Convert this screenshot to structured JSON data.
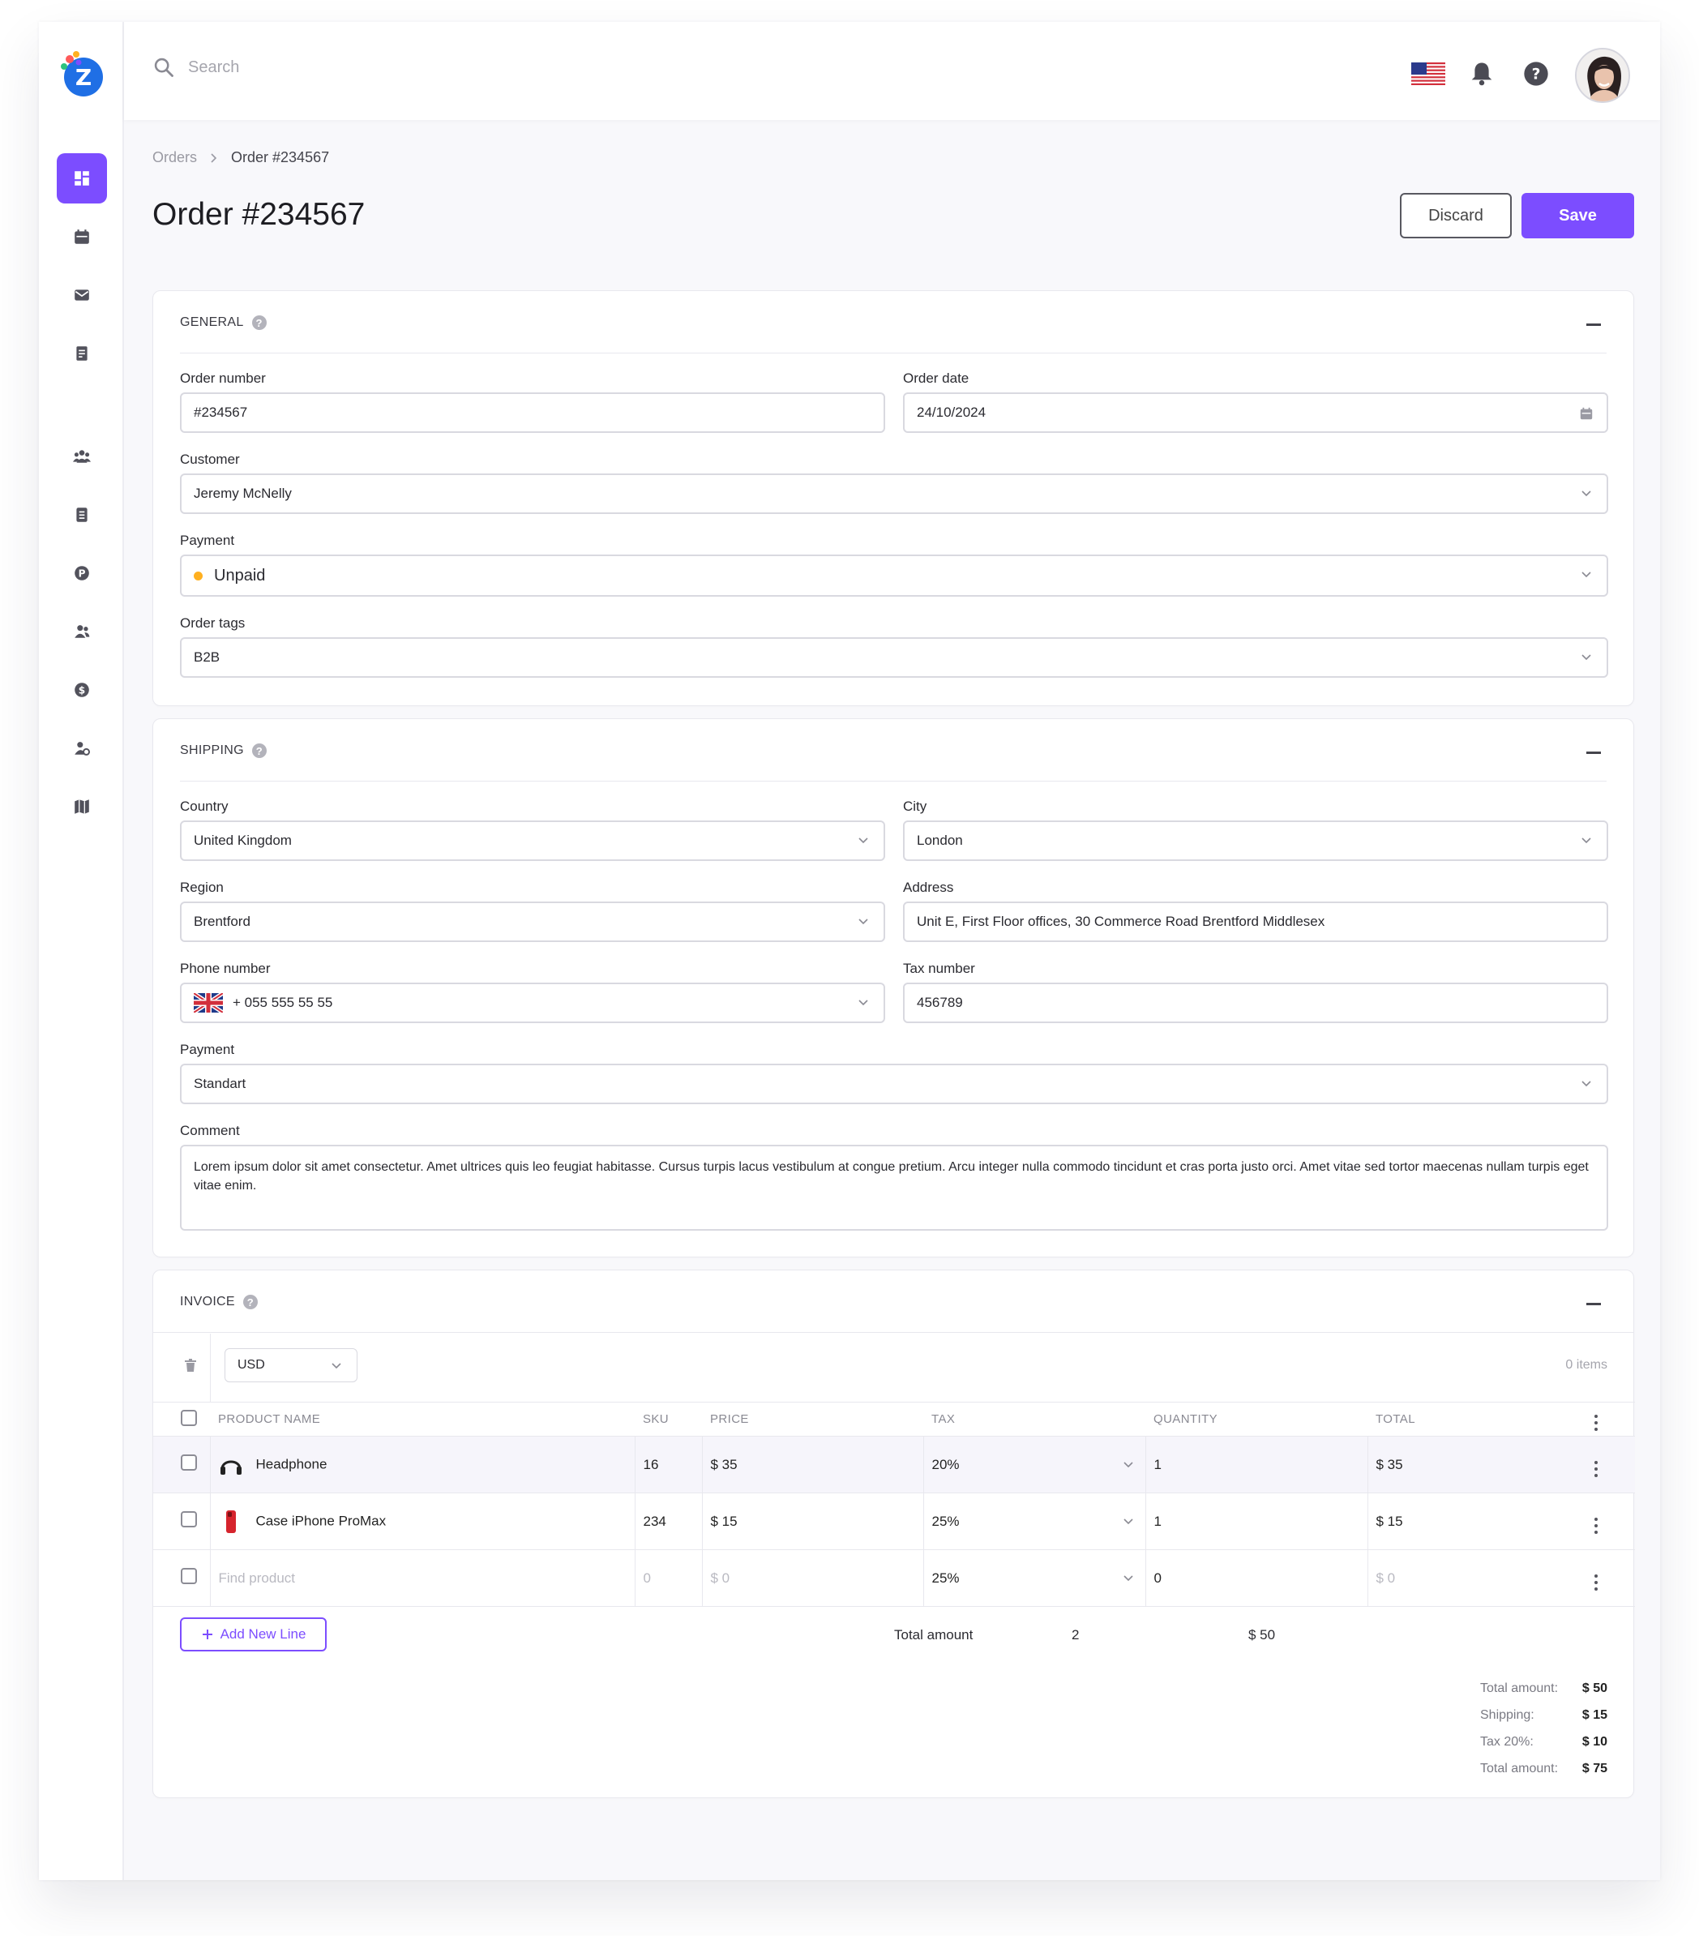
{
  "brand": {
    "logo_letter": "Z",
    "accent": "#7c4dff"
  },
  "sidebar": {
    "items": [
      {
        "name": "dashboard-icon",
        "active": true
      },
      {
        "name": "calendar-icon"
      },
      {
        "name": "mail-icon"
      },
      {
        "name": "invoice-icon"
      },
      {
        "name": "users-icon"
      },
      {
        "name": "document-icon"
      },
      {
        "name": "payment-p-icon"
      },
      {
        "name": "contacts-icon"
      },
      {
        "name": "dollar-icon"
      },
      {
        "name": "user-settings-icon"
      },
      {
        "name": "map-icon"
      }
    ]
  },
  "topbar": {
    "search_placeholder": "Search"
  },
  "breadcrumb": {
    "parent": "Orders",
    "current": "Order #234567"
  },
  "page": {
    "title": "Order #234567",
    "discard": "Discard",
    "save": "Save"
  },
  "general": {
    "header": "GENERAL",
    "order_number_label": "Order number",
    "order_number": "#234567",
    "order_date_label": "Order date",
    "order_date": "24/10/2024",
    "customer_label": "Customer",
    "customer": "Jeremy McNelly",
    "payment_label": "Payment",
    "payment": "Unpaid",
    "payment_status_color": "#ffb020",
    "tags_label": "Order tags",
    "tags": "B2B"
  },
  "shipping": {
    "header": "SHIPPING",
    "country_label": "Country",
    "country": "United Kingdom",
    "city_label": "City",
    "city": "London",
    "region_label": "Region",
    "region": "Brentford",
    "address_label": "Address",
    "address": "Unit E, First Floor offices, 30 Commerce Road Brentford Middlesex",
    "phone_label": "Phone number",
    "phone": "+ 055 555 55 55",
    "tax_label": "Tax number",
    "tax": "456789",
    "payment_label": "Payment",
    "payment": "Standart",
    "comment_label": "Comment",
    "comment": "Lorem ipsum dolor sit amet consectetur. Amet ultrices quis leo feugiat habitasse. Cursus turpis lacus vestibulum at congue pretium. Arcu integer nulla commodo tincidunt et cras porta justo orci. Amet vitae sed tortor maecenas nullam turpis eget vitae enim."
  },
  "invoice": {
    "header": "INVOICE",
    "currency": "USD",
    "items_count": "0 items",
    "columns": {
      "product": "PRODUCT NAME",
      "sku": "SKU",
      "price": "PRICE",
      "tax": "TAX",
      "quantity": "QUANTITY",
      "total": "TOTAL"
    },
    "rows": [
      {
        "product": "Headphone",
        "icon": "headphone-icon",
        "sku": "16",
        "price": "$ 35",
        "tax": "20%",
        "quantity": "1",
        "total": "$ 35"
      },
      {
        "product": "Case iPhone ProMax",
        "icon": "phone-case-icon",
        "sku": "234",
        "price": "$ 15",
        "tax": "25%",
        "quantity": "1",
        "total": "$ 15"
      },
      {
        "product": "Find product",
        "sku": "0",
        "price": "$ 0",
        "tax": "25%",
        "quantity": "0",
        "total": "$ 0"
      }
    ],
    "add_line": "Add New Line",
    "summary": {
      "label": "Total amount",
      "quantity": "2",
      "amount": "$ 50"
    },
    "totals": [
      {
        "label": "Total amount:",
        "value": "$ 50"
      },
      {
        "label": "Shipping:",
        "value": "$ 15"
      },
      {
        "label": "Tax 20%:",
        "value": "$ 10"
      },
      {
        "label": "Total amount:",
        "value": "$ 75"
      }
    ]
  }
}
